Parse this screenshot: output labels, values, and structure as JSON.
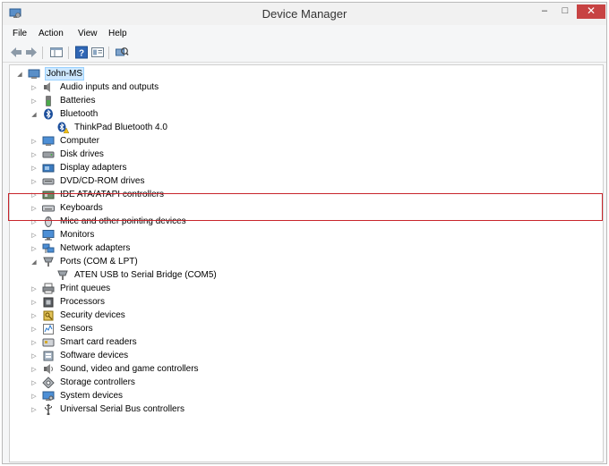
{
  "window": {
    "title": "Device Manager",
    "min": "–",
    "max": "□",
    "close": "✕"
  },
  "menu": {
    "file": "File",
    "action": "Action",
    "view": "View",
    "help": "Help"
  },
  "tree": {
    "root": "John-MS",
    "items": [
      {
        "label": "Audio inputs and outputs",
        "icon": "speaker-icon",
        "expanded": false
      },
      {
        "label": "Batteries",
        "icon": "battery-icon",
        "expanded": false
      },
      {
        "label": "Bluetooth",
        "icon": "bluetooth-icon",
        "expanded": true,
        "children": [
          {
            "label": "ThinkPad Bluetooth 4.0",
            "icon": "bluetooth-warning-icon"
          }
        ]
      },
      {
        "label": "Computer",
        "icon": "computer-icon",
        "expanded": false
      },
      {
        "label": "Disk drives",
        "icon": "disk-drive-icon",
        "expanded": false
      },
      {
        "label": "Display adapters",
        "icon": "display-adapter-icon",
        "expanded": false
      },
      {
        "label": "DVD/CD-ROM drives",
        "icon": "dvd-drive-icon",
        "expanded": false
      },
      {
        "label": "IDE ATA/ATAPI controllers",
        "icon": "ide-controller-icon",
        "expanded": false
      },
      {
        "label": "Keyboards",
        "icon": "keyboard-icon",
        "expanded": false
      },
      {
        "label": "Mice and other pointing devices",
        "icon": "mouse-icon",
        "expanded": false
      },
      {
        "label": "Monitors",
        "icon": "monitor-icon",
        "expanded": false
      },
      {
        "label": "Network adapters",
        "icon": "network-adapter-icon",
        "expanded": false
      },
      {
        "label": "Ports (COM & LPT)",
        "icon": "port-icon",
        "expanded": true,
        "children": [
          {
            "label": "ATEN USB to Serial Bridge (COM5)",
            "icon": "port-icon"
          }
        ]
      },
      {
        "label": "Print queues",
        "icon": "printer-icon",
        "expanded": false
      },
      {
        "label": "Processors",
        "icon": "processor-icon",
        "expanded": false
      },
      {
        "label": "Security devices",
        "icon": "security-device-icon",
        "expanded": false
      },
      {
        "label": "Sensors",
        "icon": "sensor-icon",
        "expanded": false
      },
      {
        "label": "Smart card readers",
        "icon": "smart-card-icon",
        "expanded": false
      },
      {
        "label": "Software devices",
        "icon": "software-device-icon",
        "expanded": false
      },
      {
        "label": "Sound, video and game controllers",
        "icon": "sound-icon",
        "expanded": false
      },
      {
        "label": "Storage controllers",
        "icon": "storage-controller-icon",
        "expanded": false
      },
      {
        "label": "System devices",
        "icon": "system-device-icon",
        "expanded": false
      },
      {
        "label": "Universal Serial Bus controllers",
        "icon": "usb-icon",
        "expanded": false
      }
    ]
  },
  "colors": {
    "highlight_border": "#c8252c",
    "selection": "#cde8ff",
    "close_button": "#c74343"
  }
}
